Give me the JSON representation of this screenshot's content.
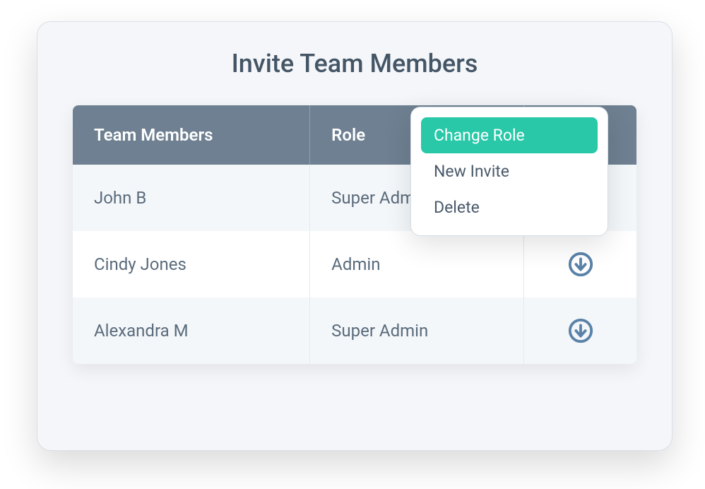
{
  "title": "Invite Team Members",
  "columns": {
    "name": "Team Members",
    "role": "Role"
  },
  "rows": [
    {
      "name": "John B",
      "role": "Super Admin"
    },
    {
      "name": "Cindy Jones",
      "role": "Admin"
    },
    {
      "name": "Alexandra M",
      "role": "Super Admin"
    }
  ],
  "dropdown": {
    "items": [
      {
        "label": "Change Role",
        "active": true
      },
      {
        "label": "New Invite",
        "active": false
      },
      {
        "label": "Delete",
        "active": false
      }
    ]
  },
  "colors": {
    "header_bg": "#6e8091",
    "accent": "#28c8a8",
    "icon": "#5a82a8"
  }
}
